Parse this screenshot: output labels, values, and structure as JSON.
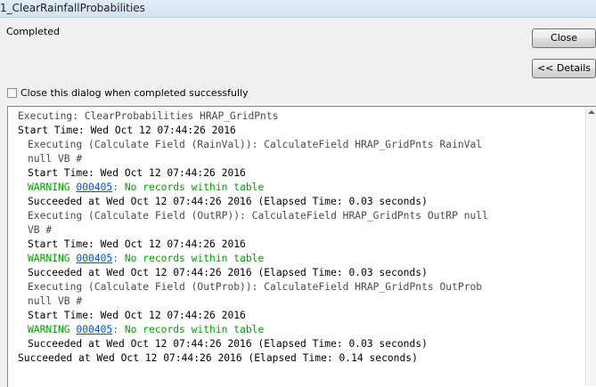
{
  "window": {
    "title": "1_ClearRainfallProbabilities"
  },
  "status": "Completed",
  "buttons": {
    "close": "Close",
    "details": "<< Details"
  },
  "checkbox": {
    "label": "Close this dialog when completed successfully",
    "checked": false
  },
  "log": [
    {
      "indent": 0,
      "style": "exec",
      "text": "Executing: ClearProbabilities HRAP_GridPnts"
    },
    {
      "indent": 0,
      "style": "msg",
      "text": "Start Time: Wed Oct 12 07:44:26 2016"
    },
    {
      "indent": 1,
      "style": "exec",
      "text": "Executing (Calculate Field (RainVal)): CalculateField HRAP_GridPnts RainVal"
    },
    {
      "indent": 1,
      "style": "exec",
      "text": "null VB #"
    },
    {
      "indent": 1,
      "style": "msg",
      "text": "Start Time: Wed Oct 12 07:44:26 2016"
    },
    {
      "indent": 1,
      "style": "warn",
      "prefix": "WARNING ",
      "code": "000405",
      "text": ": No records within table"
    },
    {
      "indent": 1,
      "style": "msg",
      "text": "Succeeded at Wed Oct 12 07:44:26 2016 (Elapsed Time: 0.03 seconds)"
    },
    {
      "indent": 1,
      "style": "exec",
      "text": "Executing (Calculate Field (OutRP)): CalculateField HRAP_GridPnts OutRP null"
    },
    {
      "indent": 1,
      "style": "exec",
      "text": "VB #"
    },
    {
      "indent": 1,
      "style": "msg",
      "text": "Start Time: Wed Oct 12 07:44:26 2016"
    },
    {
      "indent": 1,
      "style": "warn",
      "prefix": "WARNING ",
      "code": "000405",
      "text": ": No records within table"
    },
    {
      "indent": 1,
      "style": "msg",
      "text": "Succeeded at Wed Oct 12 07:44:26 2016 (Elapsed Time: 0.03 seconds)"
    },
    {
      "indent": 1,
      "style": "exec",
      "text": "Executing (Calculate Field (OutProb)): CalculateField HRAP_GridPnts OutProb"
    },
    {
      "indent": 1,
      "style": "exec",
      "text": "null VB #"
    },
    {
      "indent": 1,
      "style": "msg",
      "text": "Start Time: Wed Oct 12 07:44:26 2016"
    },
    {
      "indent": 1,
      "style": "warn",
      "prefix": "WARNING ",
      "code": "000405",
      "text": ": No records within table"
    },
    {
      "indent": 1,
      "style": "msg",
      "text": "Succeeded at Wed Oct 12 07:44:26 2016 (Elapsed Time: 0.03 seconds)"
    },
    {
      "indent": 0,
      "style": "msg",
      "text": "Succeeded at Wed Oct 12 07:44:26 2016 (Elapsed Time: 0.14 seconds)"
    }
  ]
}
